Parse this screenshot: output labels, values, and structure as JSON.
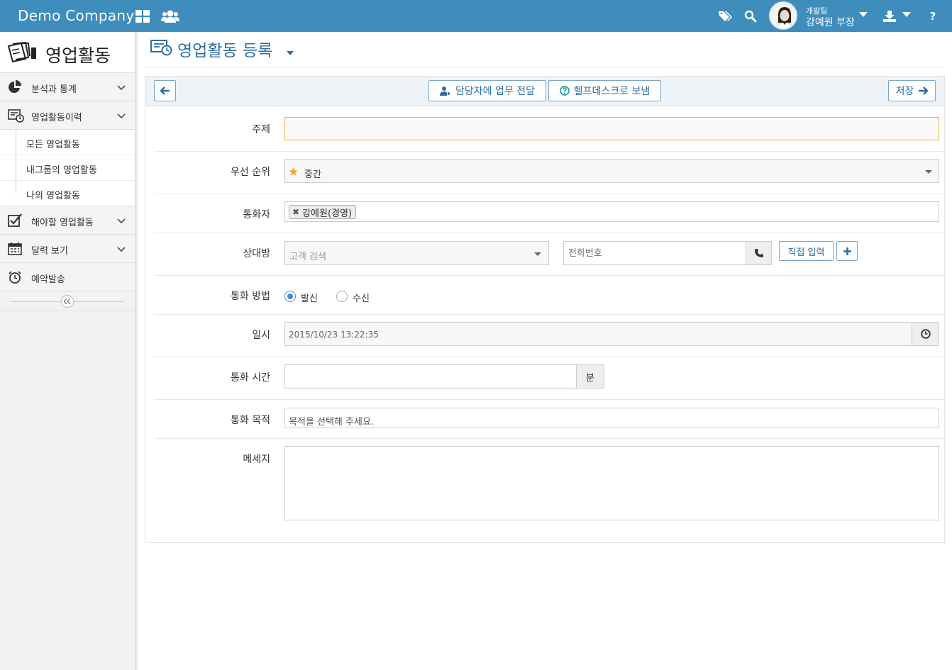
{
  "topbar": {
    "brand": "Demo Company",
    "icons": [
      "apps-grid-icon",
      "users-icon",
      "tag-icon",
      "search-icon",
      "download-icon",
      "help-icon"
    ],
    "user_team": "개발팀",
    "user_name": "강예원 부장",
    "help_glyph": "?"
  },
  "sidebar": {
    "title": "영업활동",
    "items": [
      {
        "label": "분석과 통계",
        "icon": "pie-chart-icon"
      },
      {
        "label": "영업활동이력",
        "icon": "history-list-icon"
      },
      {
        "label": "해야할 영업활동",
        "icon": "checkbox-icon"
      },
      {
        "label": "달력 보기",
        "icon": "calendar-icon"
      },
      {
        "label": "예약발송",
        "icon": "alarm-clock-icon"
      }
    ],
    "sub_items": [
      "모든 영업활동",
      "내그룹의 영업활동",
      "나의 영업활동"
    ]
  },
  "main": {
    "title": "영업활동 등록",
    "toolbar": {
      "forward_label": "담당자에 업무 전달",
      "helpdesk_label": "헬프데스크로 보냄",
      "save_label": "저장"
    },
    "form": {
      "subject_label": "주제",
      "subject_value": "",
      "priority_label": "우선 순위",
      "priority_value": "중간",
      "caller_label": "통화자",
      "caller_tag": "강예원(경영)",
      "counterpart_label": "상대방",
      "customer_placeholder": "고객 검색",
      "phone_placeholder": "전화번호",
      "direct_input_label": "직접 입력",
      "method_label": "통화 방법",
      "method_options": [
        "발신",
        "수신"
      ],
      "method_selected": "발신",
      "datetime_label": "일시",
      "datetime_value": "2015/10/23 13:22:35",
      "duration_label": "통화 시간",
      "duration_unit": "분",
      "purpose_label": "통화 목적",
      "purpose_placeholder": "목적을 선택해 주세요.",
      "message_label": "메세지"
    }
  },
  "colors": {
    "topbar": "#3e8dbd",
    "link_blue": "#2e6da4",
    "star": "#f5a623",
    "focus_border": "#f0ad4e"
  }
}
